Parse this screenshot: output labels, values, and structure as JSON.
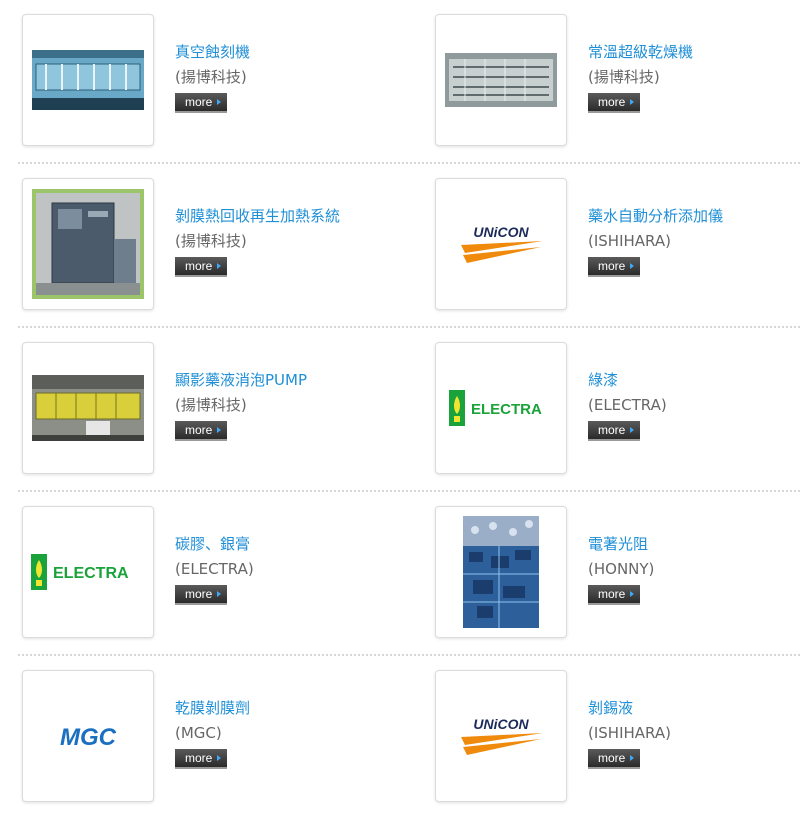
{
  "more_label": "more",
  "logos": {
    "unicon": "UNiCON",
    "electra": "ELECTRA",
    "mgc": "MGC"
  },
  "products": [
    {
      "title": "真空蝕刻機",
      "maker": "(揚博科技)",
      "image": "vacuum-etcher-photo"
    },
    {
      "title": "常溫超級乾燥機",
      "maker": "(揚博科技)",
      "image": "dryer-photo"
    },
    {
      "title": "剝膜熱回收再生加熱系統",
      "maker": "(揚博科技)",
      "image": "heat-recovery-cabinet-photo"
    },
    {
      "title": "藥水自動分析添加儀",
      "maker": "(ISHIHARA)",
      "image": "unicon-logo"
    },
    {
      "title": "顯影藥液消泡PUMP",
      "maker": "(揚博科技)",
      "image": "developer-line-photo"
    },
    {
      "title": "綠漆",
      "maker": "(ELECTRA)",
      "image": "electra-logo"
    },
    {
      "title": "碳膠、銀膏",
      "maker": "(ELECTRA)",
      "image": "electra-logo"
    },
    {
      "title": "電著光阻",
      "maker": "(HONNY)",
      "image": "circuit-board-photo"
    },
    {
      "title": "乾膜剝膜劑",
      "maker": "(MGC)",
      "image": "mgc-logo"
    },
    {
      "title": "剝錫液",
      "maker": "(ISHIHARA)",
      "image": "unicon-logo"
    }
  ],
  "colors": {
    "title": "#1f8fd6",
    "maker": "#666666",
    "electra_green": "#1aa33a",
    "unicon_orange": "#f08a0c",
    "mgc_blue": "#1a6fc0"
  }
}
